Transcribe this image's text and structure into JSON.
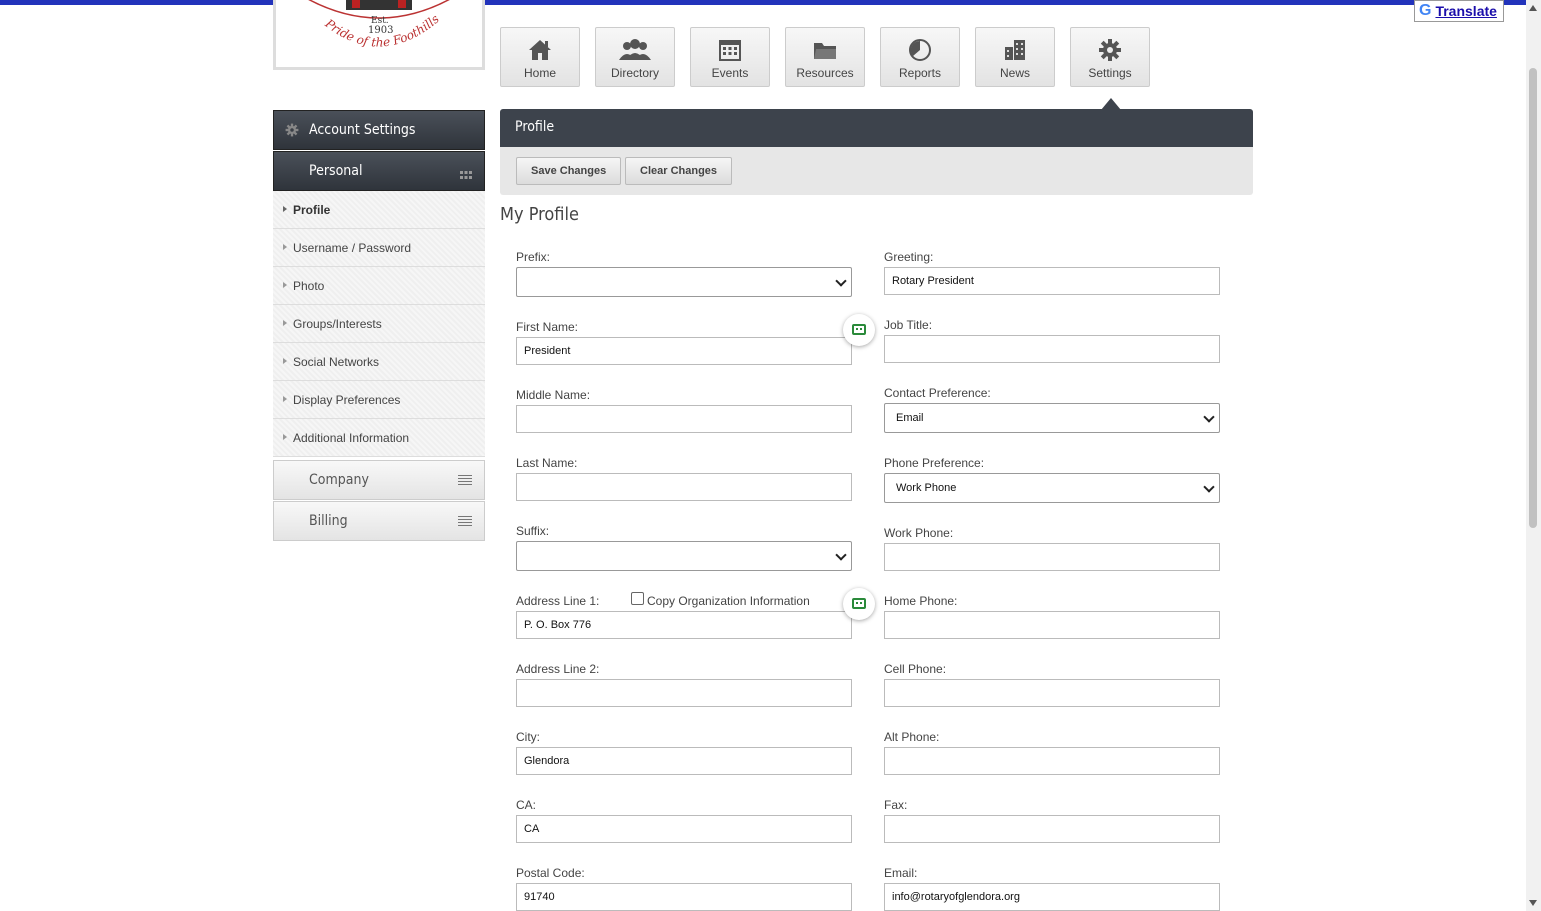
{
  "translate": {
    "label": "Translate"
  },
  "logo": {
    "est": "Est.",
    "year": "1903",
    "motto": "Pride of the Foothills"
  },
  "nav": [
    {
      "label": "Home",
      "icon": "home-icon"
    },
    {
      "label": "Directory",
      "icon": "people-icon"
    },
    {
      "label": "Events",
      "icon": "calendar-icon"
    },
    {
      "label": "Resources",
      "icon": "folder-icon"
    },
    {
      "label": "Reports",
      "icon": "pie-chart-icon"
    },
    {
      "label": "News",
      "icon": "buildings-icon"
    },
    {
      "label": "Settings",
      "icon": "gear-icon"
    }
  ],
  "sidebar": {
    "header": "Account Settings",
    "personal": "Personal",
    "items": [
      {
        "label": "Profile"
      },
      {
        "label": "Username / Password"
      },
      {
        "label": "Photo"
      },
      {
        "label": "Groups/Interests"
      },
      {
        "label": "Social Networks"
      },
      {
        "label": "Display Preferences"
      },
      {
        "label": "Additional Information"
      }
    ],
    "company": "Company",
    "billing": "Billing"
  },
  "panel": {
    "title": "Profile",
    "save": "Save Changes",
    "clear": "Clear Changes",
    "section": "My Profile"
  },
  "form": {
    "prefix": {
      "label": "Prefix:",
      "value": ""
    },
    "first_name": {
      "label": "First Name:",
      "value": "President"
    },
    "middle_name": {
      "label": "Middle Name:",
      "value": ""
    },
    "last_name": {
      "label": "Last Name:",
      "value": ""
    },
    "suffix": {
      "label": "Suffix:",
      "value": ""
    },
    "address1": {
      "label": "Address Line 1:",
      "value": "P. O. Box 776",
      "copy_label": "Copy Organization Information"
    },
    "address2": {
      "label": "Address Line 2:",
      "value": ""
    },
    "city": {
      "label": "City:",
      "value": "Glendora"
    },
    "state": {
      "label": "CA:",
      "value": "CA"
    },
    "postal": {
      "label": "Postal Code:",
      "value": "91740"
    },
    "greeting": {
      "label": "Greeting:",
      "value": "Rotary President"
    },
    "job_title": {
      "label": "Job Title:",
      "value": ""
    },
    "contact_pref": {
      "label": "Contact Preference:",
      "value": "Email"
    },
    "phone_pref": {
      "label": "Phone Preference:",
      "value": "Work Phone"
    },
    "work_phone": {
      "label": "Work Phone:",
      "value": ""
    },
    "home_phone": {
      "label": "Home Phone:",
      "value": ""
    },
    "cell_phone": {
      "label": "Cell Phone:",
      "value": ""
    },
    "alt_phone": {
      "label": "Alt Phone:",
      "value": ""
    },
    "fax": {
      "label": "Fax:",
      "value": ""
    },
    "email": {
      "label": "Email:",
      "value": "info@rotaryofglendora.org"
    }
  }
}
